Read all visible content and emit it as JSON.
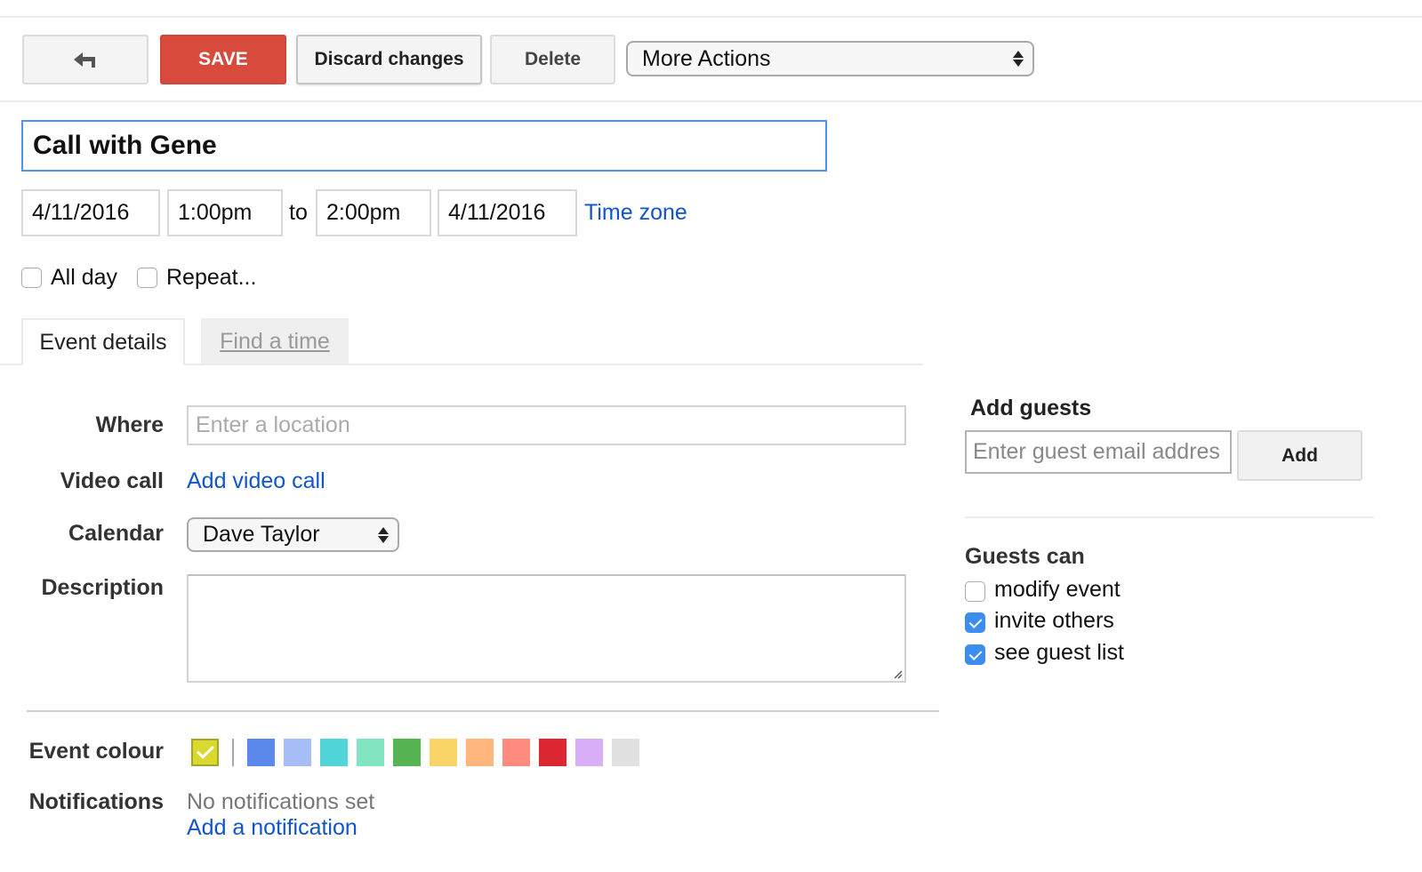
{
  "toolbar": {
    "back_icon": "back-arrow-icon",
    "save_label": "SAVE",
    "discard_label": "Discard changes",
    "delete_label": "Delete",
    "more_actions": {
      "selected": "More Actions"
    }
  },
  "event": {
    "title": "Call with Gene",
    "start_date": "4/11/2016",
    "start_time": "1:00pm",
    "to_label": "to",
    "end_time": "2:00pm",
    "end_date": "4/11/2016",
    "time_zone_link": "Time zone",
    "all_day": {
      "label": "All day",
      "checked": false
    },
    "repeat": {
      "label": "Repeat...",
      "checked": false
    }
  },
  "tabs": [
    {
      "label": "Event details",
      "active": true
    },
    {
      "label": "Find a time",
      "active": false
    }
  ],
  "details": {
    "where": {
      "label": "Where",
      "placeholder": "Enter a location",
      "value": ""
    },
    "video_call": {
      "label": "Video call",
      "link": "Add video call"
    },
    "calendar": {
      "label": "Calendar",
      "selected": "Dave Taylor"
    },
    "description": {
      "label": "Description",
      "value": ""
    },
    "event_colour": {
      "label": "Event colour",
      "selected": "#dada2e",
      "swatches": [
        "#5a88eb",
        "#a6bdf8",
        "#51d5d9",
        "#81e5c2",
        "#57b452",
        "#f9d567",
        "#ffb77e",
        "#ff8a7e",
        "#dc2631",
        "#d9aff9",
        "#e1e1e1"
      ]
    },
    "notifications": {
      "label": "Notifications",
      "status": "No notifications set",
      "add_link": "Add a notification"
    }
  },
  "guests": {
    "heading": "Add guests",
    "input_placeholder": "Enter guest email addres",
    "add_label": "Add",
    "permissions_heading": "Guests can",
    "permissions": [
      {
        "label": "modify event",
        "checked": false
      },
      {
        "label": "invite others",
        "checked": true
      },
      {
        "label": "see guest list",
        "checked": true
      }
    ]
  }
}
